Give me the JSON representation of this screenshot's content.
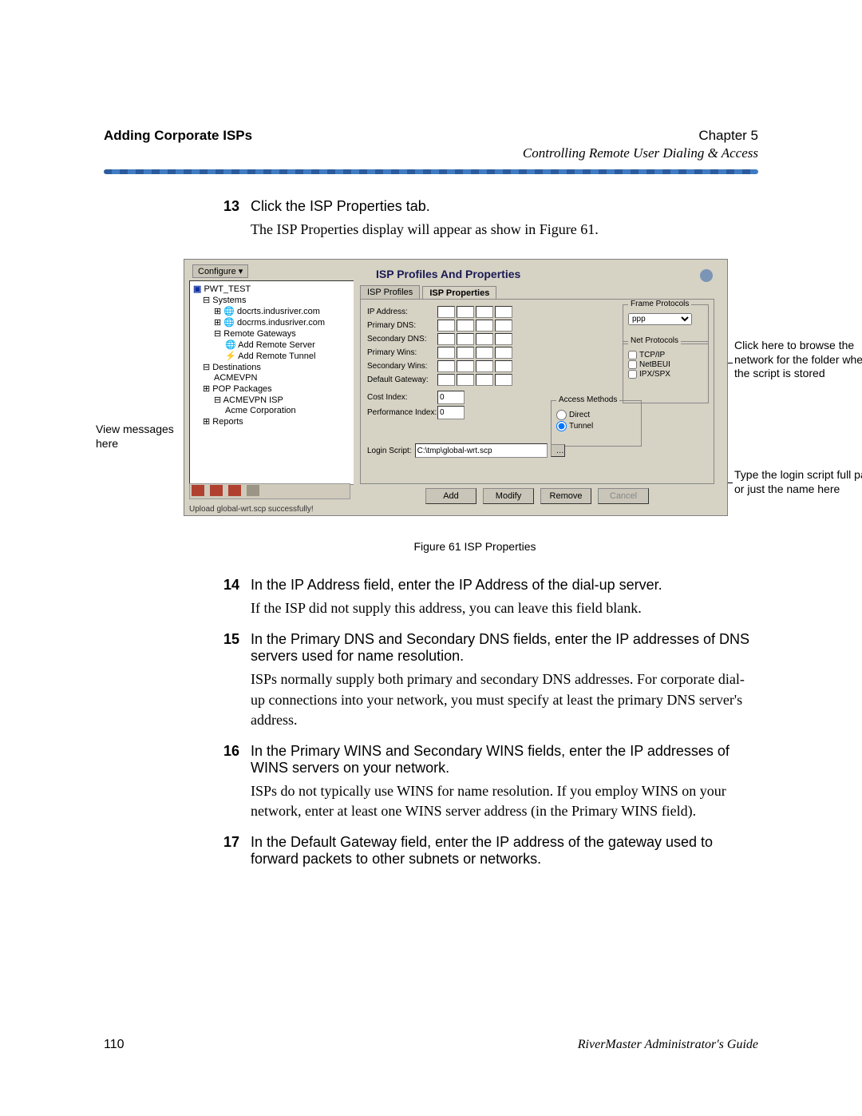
{
  "header": {
    "left": "Adding Corporate ISPs",
    "chapter": "Chapter 5",
    "subtitle": "Controlling Remote User Dialing & Access"
  },
  "steps": {
    "s13": {
      "num": "13",
      "lead": "Click the ISP Properties tab.",
      "follow": "The ISP Properties display will appear as show in Figure 61."
    },
    "s14": {
      "num": "14",
      "lead": "In the IP Address field, enter the IP Address of the dial-up server.",
      "follow": "If the ISP did not supply this address, you can leave this field blank."
    },
    "s15": {
      "num": "15",
      "lead": "In the Primary DNS and Secondary DNS fields, enter the IP addresses of DNS servers used for name resolution.",
      "follow": "ISPs normally supply both primary and secondary DNS addresses. For corporate dial-up connections into your network, you must specify at least the primary DNS server's address."
    },
    "s16": {
      "num": "16",
      "lead": "In the Primary WINS and Secondary WINS fields, enter the IP addresses of WINS servers on your network.",
      "follow": "ISPs do not typically use WINS for name resolution. If you employ WINS on your network, enter at least one WINS server address (in the Primary WINS field)."
    },
    "s17": {
      "num": "17",
      "lead": "In the Default Gateway field, enter the IP address of the gateway used to forward packets to other subnets or networks."
    }
  },
  "callouts": {
    "left": "View messages here",
    "right1": "Click here to browse the network for the folder where the script is stored",
    "right2": "Type the login script full path or just the name here"
  },
  "shot": {
    "configure": "Configure ▾",
    "tree": {
      "root": "PWT_TEST",
      "systems": "Systems",
      "n1": "docrts.indusriver.com",
      "n2": "docrms.indusriver.com",
      "rg": "Remote Gateways",
      "ars": "Add Remote Server",
      "art": "Add Remote Tunnel",
      "dest": "Destinations",
      "acme": "ACMEVPN",
      "pop": "POP Packages",
      "isp": "ACMEVPN ISP",
      "corp": "Acme Corporation",
      "reports": "Reports"
    },
    "status": "Upload global-wrt.scp successfully!",
    "panelTitle": "ISP Profiles And Properties",
    "tabs": {
      "t1": "ISP Profiles",
      "t2": "ISP Properties"
    },
    "labels": {
      "ip": "IP Address:",
      "pdns": "Primary DNS:",
      "sdns": "Secondary DNS:",
      "pwins": "Primary Wins:",
      "swins": "Secondary Wins:",
      "gw": "Default Gateway:",
      "cost": "Cost Index:",
      "perf": "Performance Index:",
      "login": "Login Script:"
    },
    "groups": {
      "frame": "Frame Protocols",
      "frameSel": "ppp",
      "net": "Net Protocols",
      "np1": "TCP/IP",
      "np2": "NetBEUI",
      "np3": "IPX/SPX",
      "access": "Access Methods",
      "am1": "Direct",
      "am2": "Tunnel"
    },
    "vals": {
      "cost": "0",
      "perf": "0",
      "script": "C:\\tmp\\global-wrt.scp"
    },
    "buttons": {
      "add": "Add",
      "modify": "Modify",
      "remove": "Remove",
      "cancel": "Cancel"
    }
  },
  "figure": {
    "caption": "Figure 61   ISP Properties"
  },
  "footer": {
    "page": "110",
    "guide": "RiverMaster Administrator's Guide"
  }
}
